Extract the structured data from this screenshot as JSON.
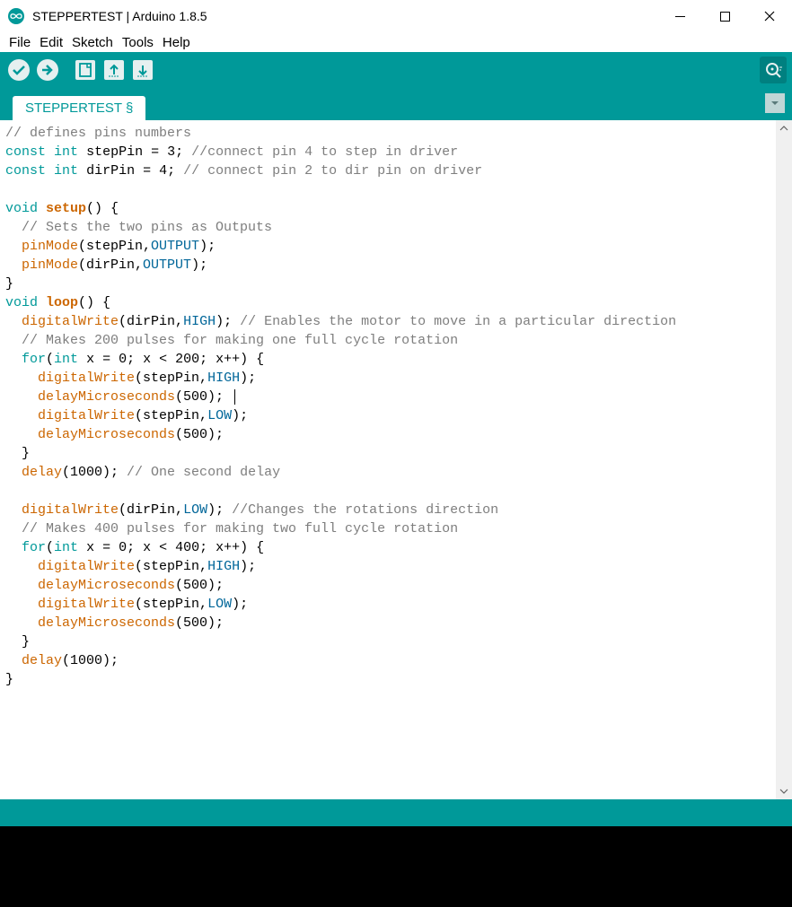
{
  "window": {
    "title": "STEPPERTEST | Arduino 1.8.5"
  },
  "menu": {
    "items": [
      "File",
      "Edit",
      "Sketch",
      "Tools",
      "Help"
    ]
  },
  "tab": {
    "name": "STEPPERTEST §"
  },
  "code": {
    "l01_cm": "// defines pins numbers",
    "l02_kw": "const",
    "l02_ty": "int",
    "l02_id": "stepPin",
    "l02_eq": " = ",
    "l02_v": "3",
    "l02_sc": ";",
    "l02_cm": " //connect pin 4 to step in driver",
    "l03_kw": "const",
    "l03_ty": "int",
    "l03_id": "dirPin",
    "l03_eq": " = ",
    "l03_v": "4",
    "l03_sc": ";",
    "l03_cm": " // connect pin 2 to dir pin on driver",
    "l05_kw": "void",
    "l05_fn": "setup",
    "l05_rest": "() {",
    "l06_cm": "  // Sets the two pins as Outputs",
    "l07_fn": "pinMode",
    "l07_a1": "(stepPin,",
    "l07_cn": "OUTPUT",
    "l07_a2": ");",
    "l08_fn": "pinMode",
    "l08_a1": "(dirPin,",
    "l08_cn": "OUTPUT",
    "l08_a2": ");",
    "l09": "}",
    "l10_kw": "void",
    "l10_fn": "loop",
    "l10_rest": "() {",
    "l11_fn": "digitalWrite",
    "l11_a1": "(dirPin,",
    "l11_cn": "HIGH",
    "l11_a2": ");",
    "l11_cm": " // Enables the motor to move in a particular direction",
    "l12_cm": "  // Makes 200 pulses for making one full cycle rotation",
    "l13_kw": "for",
    "l13_p1": "(",
    "l13_ty": "int",
    "l13_rest": " x = 0; x < 200; x++) {",
    "l14_fn": "digitalWrite",
    "l14_a1": "(stepPin,",
    "l14_cn": "HIGH",
    "l14_a2": ");",
    "l15_fn": "delayMicroseconds",
    "l15_a": "(500); ",
    "l16_fn": "digitalWrite",
    "l16_a1": "(stepPin,",
    "l16_cn": "LOW",
    "l16_a2": ");",
    "l17_fn": "delayMicroseconds",
    "l17_a": "(500);",
    "l18": "  }",
    "l19_fn": "delay",
    "l19_a": "(1000);",
    "l19_cm": " // One second delay",
    "l21_fn": "digitalWrite",
    "l21_a1": "(dirPin,",
    "l21_cn": "LOW",
    "l21_a2": ");",
    "l21_cm": " //Changes the rotations direction",
    "l22_cm": "  // Makes 400 pulses for making two full cycle rotation",
    "l23_kw": "for",
    "l23_p1": "(",
    "l23_ty": "int",
    "l23_rest": " x = 0; x < 400; x++) {",
    "l24_fn": "digitalWrite",
    "l24_a1": "(stepPin,",
    "l24_cn": "HIGH",
    "l24_a2": ");",
    "l25_fn": "delayMicroseconds",
    "l25_a": "(500);",
    "l26_fn": "digitalWrite",
    "l26_a1": "(stepPin,",
    "l26_cn": "LOW",
    "l26_a2": ");",
    "l27_fn": "delayMicroseconds",
    "l27_a": "(500);",
    "l28": "  }",
    "l29_fn": "delay",
    "l29_a": "(1000);",
    "l30": "}"
  }
}
